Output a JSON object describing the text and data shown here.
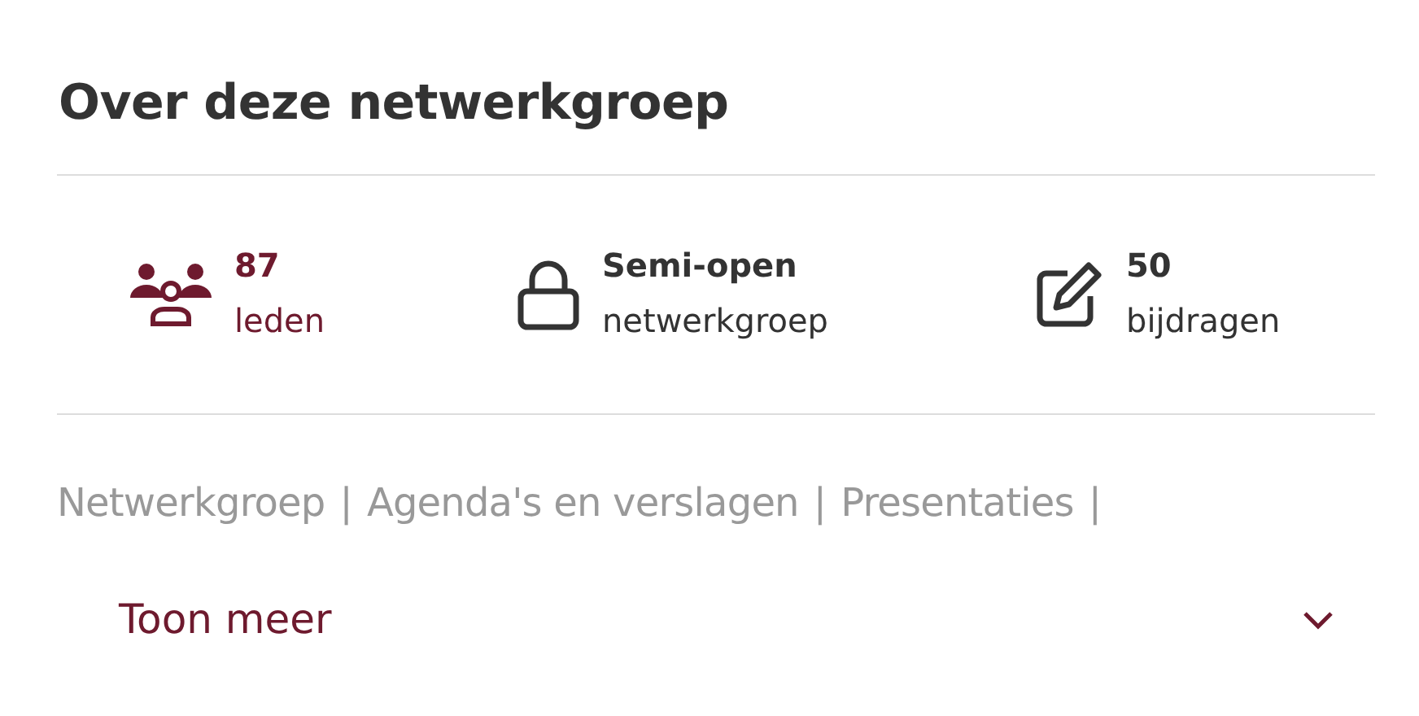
{
  "title": "Over deze netwerkgroep",
  "stats": [
    {
      "kind": "members",
      "value": "87",
      "label": "leden",
      "color": "#6e1a2e"
    },
    {
      "kind": "access",
      "value": "Semi-open",
      "label": "netwerkgroep",
      "color": "#333333"
    },
    {
      "kind": "posts",
      "value": "50",
      "label": "bijdragen",
      "color": "#333333"
    }
  ],
  "tags": [
    "Netwerkgroep",
    "Agenda's en verslagen",
    "Presentaties"
  ],
  "tag_separator": "|",
  "show_more": {
    "label": "Toon meer",
    "expanded": false
  }
}
